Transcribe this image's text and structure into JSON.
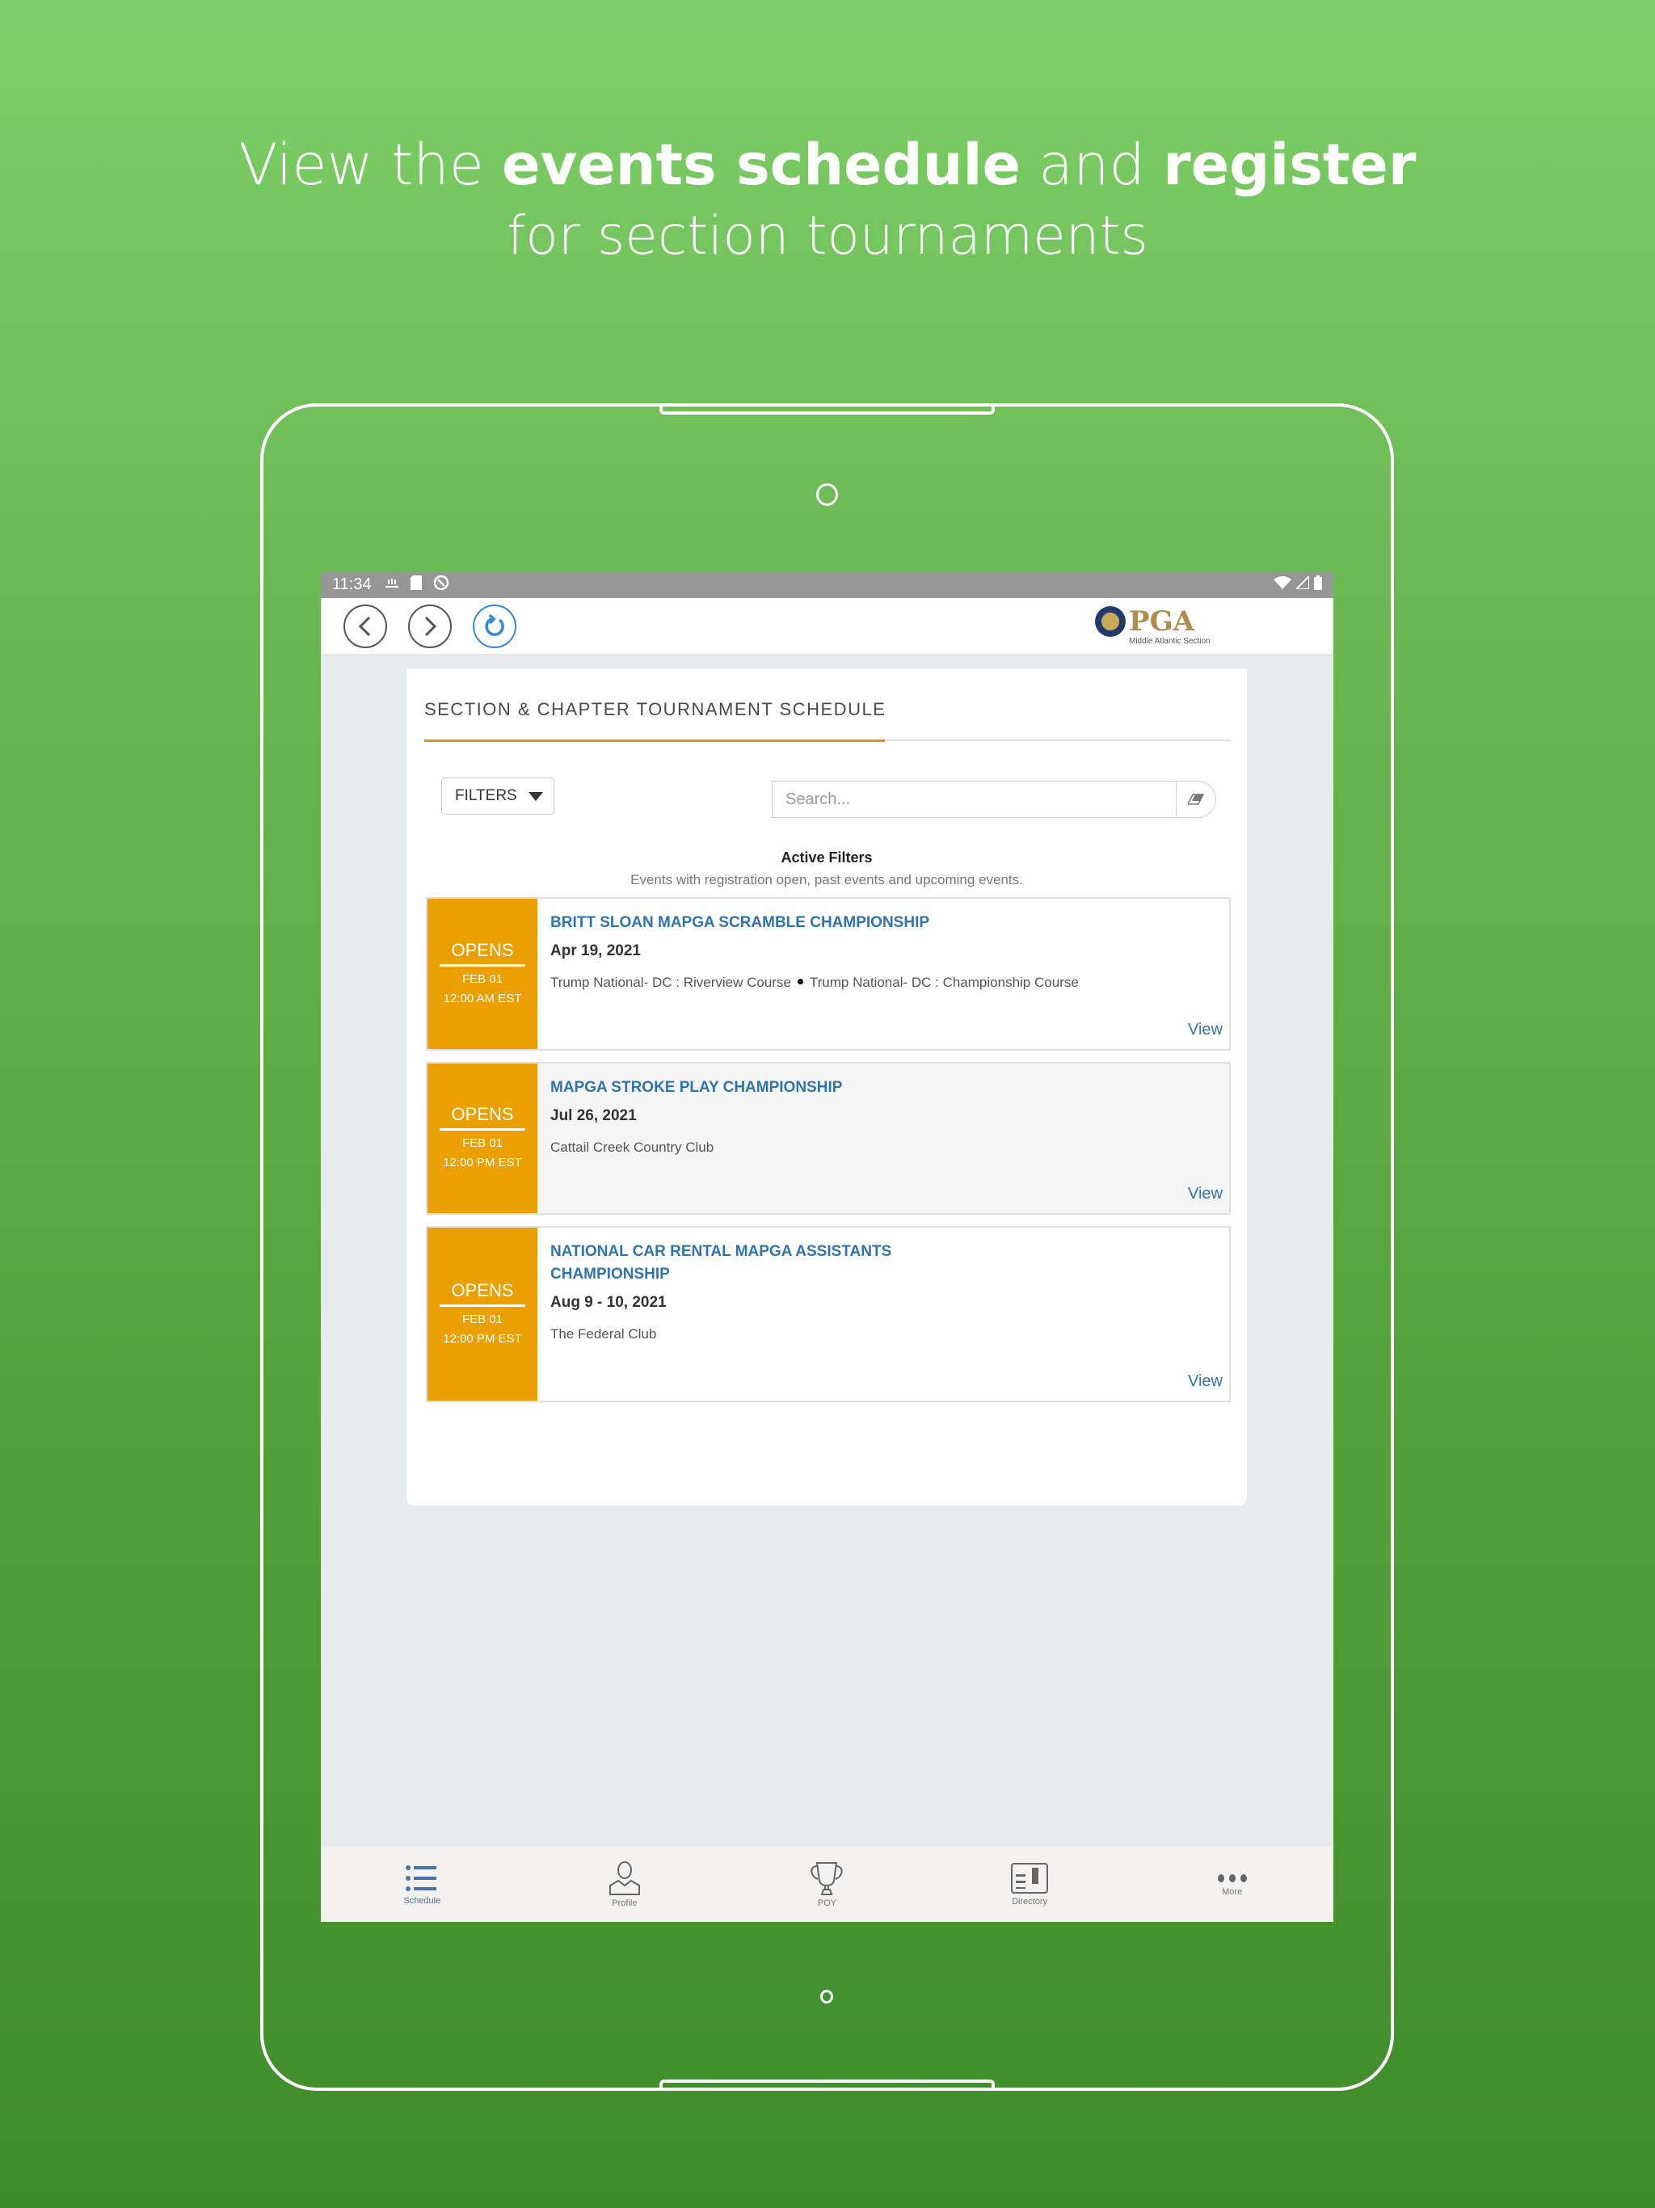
{
  "headline": {
    "part1": "View the ",
    "bold1": "events schedule",
    "part2": " and ",
    "bold2": "register",
    "line2": "for section tournaments"
  },
  "statusbar": {
    "time": "11:34",
    "left_icons": [
      "golf-app-icon",
      "sd-card-icon",
      "sync-icon"
    ],
    "right_icons": [
      "wifi-icon",
      "signal-icon",
      "battery-icon"
    ]
  },
  "navbar": {
    "back_icon": "chevron-left-icon",
    "forward_icon": "chevron-right-icon",
    "refresh_icon": "refresh-icon",
    "logo_text": "PGA",
    "logo_subtitle": "Middle Atlantic Section"
  },
  "page": {
    "title": "SECTION & CHAPTER TOURNAMENT SCHEDULE",
    "filters_label": "FILTERS",
    "search_placeholder": "Search...",
    "search_value": "",
    "active_filters_title": "Active Filters",
    "active_filters_desc": "Events with registration open, past events and upcoming events.",
    "accent_color": "#e68a1e",
    "badge_color": "#eba000",
    "link_color": "#2f74b0"
  },
  "events": [
    {
      "badge_label": "OPENS",
      "badge_date": "FEB  01",
      "badge_time": "12:00 AM EST",
      "name": "BRITT SLOAN MAPGA SCRAMBLE CHAMPIONSHIP",
      "date": "Apr 19, 2021",
      "venues": [
        "Trump National- DC : Riverview Course",
        "Trump National- DC : Championship Course"
      ],
      "view_label": "View"
    },
    {
      "badge_label": "OPENS",
      "badge_date": "FEB  01",
      "badge_time": "12:00 PM EST",
      "name": "MAPGA STROKE PLAY CHAMPIONSHIP",
      "date": "Jul 26, 2021",
      "venues": [
        "Cattail Creek Country Club"
      ],
      "view_label": "View"
    },
    {
      "badge_label": "OPENS",
      "badge_date": "FEB  01",
      "badge_time": "12:00 PM EST",
      "name": "NATIONAL CAR RENTAL MAPGA ASSISTANTS CHAMPIONSHIP",
      "date": "Aug 9 - 10, 2021",
      "venues": [
        "The Federal Club"
      ],
      "view_label": "View"
    }
  ],
  "tabbar": {
    "active": "Schedule",
    "items": [
      {
        "label": "Schedule",
        "icon": "list-icon"
      },
      {
        "label": "Profile",
        "icon": "person-icon"
      },
      {
        "label": "POY",
        "icon": "trophy-icon"
      },
      {
        "label": "Directory",
        "icon": "directory-icon"
      },
      {
        "label": "More",
        "icon": "more-icon"
      }
    ]
  }
}
